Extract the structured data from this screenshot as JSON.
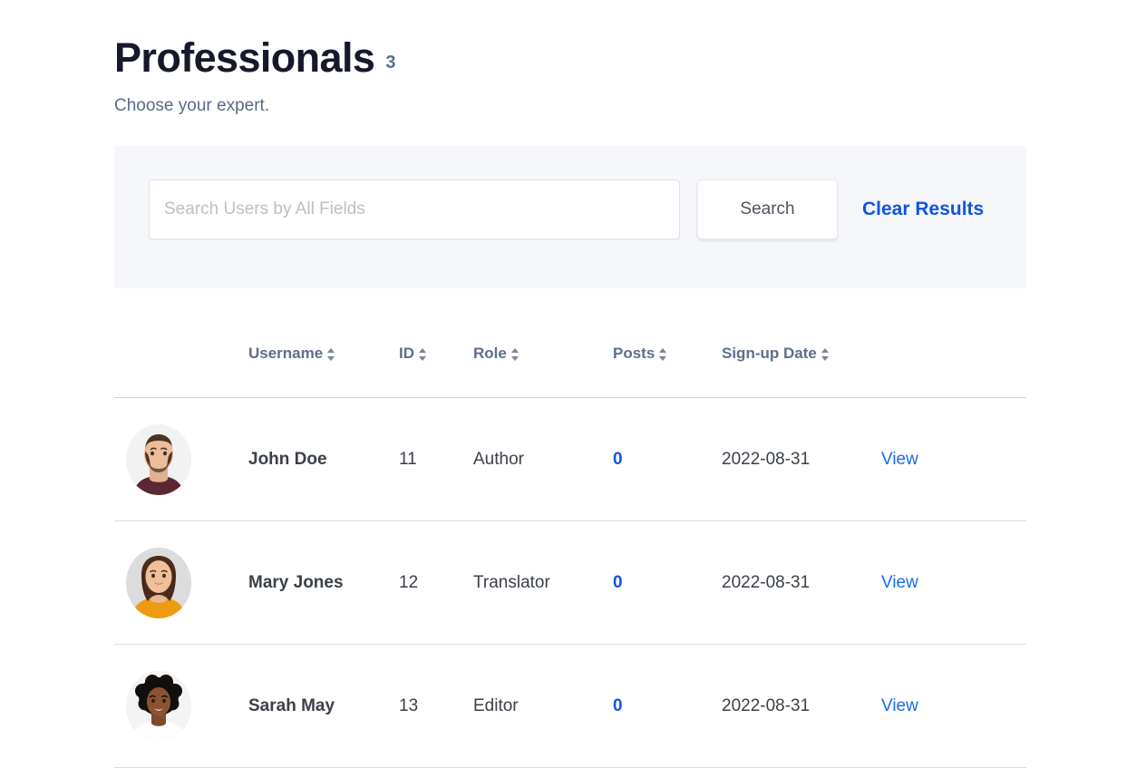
{
  "header": {
    "title": "Professionals",
    "count": "3",
    "subtitle": "Choose your expert."
  },
  "search": {
    "placeholder": "Search Users by All Fields",
    "value": "",
    "search_label": "Search",
    "clear_label": "Clear Results"
  },
  "table": {
    "columns": [
      {
        "key": "avatar",
        "label": "",
        "sortable": false
      },
      {
        "key": "username",
        "label": "Username",
        "sortable": true
      },
      {
        "key": "id",
        "label": "ID",
        "sortable": true
      },
      {
        "key": "role",
        "label": "Role",
        "sortable": true
      },
      {
        "key": "posts",
        "label": "Posts",
        "sortable": true
      },
      {
        "key": "date",
        "label": "Sign-up Date",
        "sortable": true
      },
      {
        "key": "action",
        "label": "",
        "sortable": false
      }
    ],
    "rows": [
      {
        "avatar_alt": "avatar-john-doe",
        "username": "John Doe",
        "id": "11",
        "role": "Author",
        "posts": "0",
        "date": "2022-08-31",
        "action": "View"
      },
      {
        "avatar_alt": "avatar-mary-jones",
        "username": "Mary Jones",
        "id": "12",
        "role": "Translator",
        "posts": "0",
        "date": "2022-08-31",
        "action": "View"
      },
      {
        "avatar_alt": "avatar-sarah-may",
        "username": "Sarah May",
        "id": "13",
        "role": "Editor",
        "posts": "0",
        "date": "2022-08-31",
        "action": "View"
      }
    ]
  },
  "colors": {
    "link": "#1155dd",
    "view_link": "#1a6aea",
    "heading": "#16192a",
    "muted": "#5d6e8c",
    "panel_bg": "#f6f7fb"
  }
}
